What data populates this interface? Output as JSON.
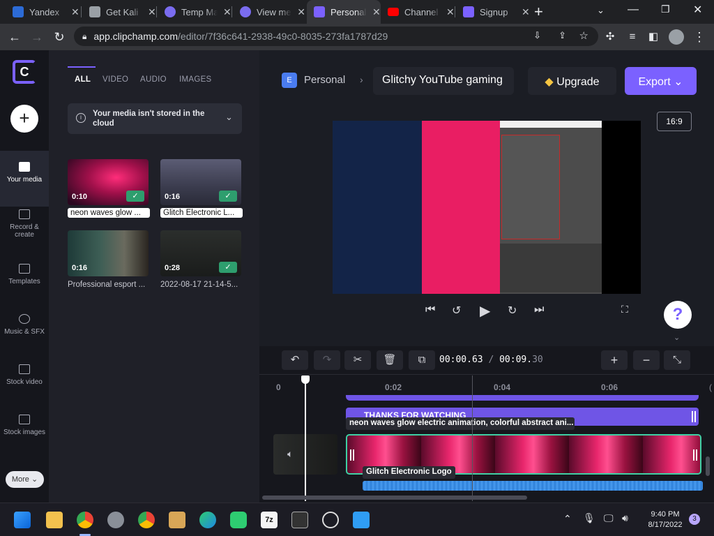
{
  "browser": {
    "tabs": [
      {
        "title": "Yandex",
        "color": "#2c6bd6"
      },
      {
        "title": "Get Kali",
        "color": "#9aa0a6"
      },
      {
        "title": "Temp Mail",
        "color": "#7a6cf0"
      },
      {
        "title": "View message",
        "color": "#7a6cf0"
      },
      {
        "title": "Personal",
        "color": "#7b61ff",
        "active": true
      },
      {
        "title": "Channel",
        "color": "#ff0000"
      },
      {
        "title": "Signup",
        "color": "#7b61ff"
      }
    ],
    "new_tab": "+",
    "url_host": "app.clipchamp.com",
    "url_path": "/editor/7f36c641-2938-49c0-8035-273fa1787d29"
  },
  "rail": {
    "logo": "C",
    "items": [
      {
        "label": "Your media",
        "icon": "folder-icon"
      },
      {
        "label": "Record & create",
        "icon": "camera-icon"
      },
      {
        "label": "Templates",
        "icon": "templates-icon"
      },
      {
        "label": "Music & SFX",
        "icon": "music-icon"
      },
      {
        "label": "Stock video",
        "icon": "film-icon"
      },
      {
        "label": "Stock images",
        "icon": "image-icon"
      }
    ],
    "more": "More"
  },
  "media": {
    "tabs": [
      "ALL",
      "VIDEO",
      "AUDIO",
      "IMAGES"
    ],
    "notice": "Your media isn't stored in the cloud",
    "items": [
      {
        "duration": "0:10",
        "name": "neon waves glow ...",
        "checked": true
      },
      {
        "duration": "0:16",
        "name": "Glitch Electronic L...",
        "checked": true
      },
      {
        "duration": "0:16",
        "name": "Professional esport ...",
        "checked": false
      },
      {
        "duration": "0:28",
        "name": "2022-08-17 21-14-5...",
        "checked": true
      }
    ]
  },
  "header": {
    "workspace_initial": "E",
    "workspace": "Personal",
    "project_title": "Glitchy YouTube gaming",
    "upgrade": "Upgrade",
    "export": "Export",
    "aspect": "16:9"
  },
  "timeline": {
    "current": "00:00.",
    "current_frac": "63",
    "separator": "/",
    "total": "00:09.",
    "total_frac": "30",
    "ticks": [
      "0",
      "0:02",
      "0:04",
      "0:06"
    ],
    "clips": {
      "text_track": "THANKS FOR WATCHING",
      "video_label": "neon waves glow electric animation, colorful abstract ani...",
      "logo_label": "Glitch Electronic Logo"
    }
  },
  "taskbar": {
    "time": "9:40 PM",
    "date": "8/17/2022",
    "notif": "3"
  }
}
